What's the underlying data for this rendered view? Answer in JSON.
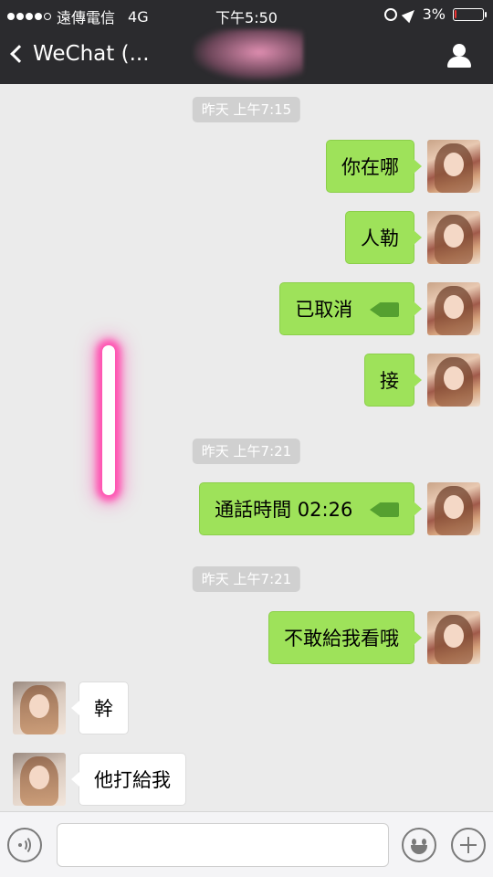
{
  "status_bar": {
    "carrier": "遠傳電信",
    "network": "4G",
    "time": "下午5:50",
    "battery_percent_label": "3%",
    "battery_level": 0.03,
    "battery_color": "#ee3333"
  },
  "nav": {
    "back_label": "WeChat (...",
    "title_obscured": true,
    "right_icon": "profile-icon"
  },
  "colors": {
    "outgoing_bubble": "#9ee25a",
    "incoming_bubble": "#ffffff",
    "chat_background": "#ebebeb",
    "header_background": "#2b2b2e",
    "annotation_glow": "#ff4fb0"
  },
  "messages": [
    {
      "type": "timestamp",
      "text": "昨天 上午7:15"
    },
    {
      "type": "outgoing",
      "text": "你在哪"
    },
    {
      "type": "outgoing",
      "text": "人勒"
    },
    {
      "type": "outgoing",
      "text": "已取消",
      "icon": "video-call-icon"
    },
    {
      "type": "outgoing",
      "text": "接"
    },
    {
      "type": "timestamp",
      "text": "昨天 上午7:21"
    },
    {
      "type": "outgoing",
      "text": "通話時間 02:26",
      "icon": "video-call-icon"
    },
    {
      "type": "timestamp",
      "text": "昨天 上午7:21"
    },
    {
      "type": "outgoing",
      "text": "不敢給我看哦"
    },
    {
      "type": "incoming",
      "text": "幹"
    },
    {
      "type": "incoming",
      "text": "他打給我"
    }
  ],
  "input_bar": {
    "left_icon": "voice-icon",
    "input_value": "",
    "emoji_icon": "emoji-icon",
    "plus_icon": "plus-icon"
  }
}
